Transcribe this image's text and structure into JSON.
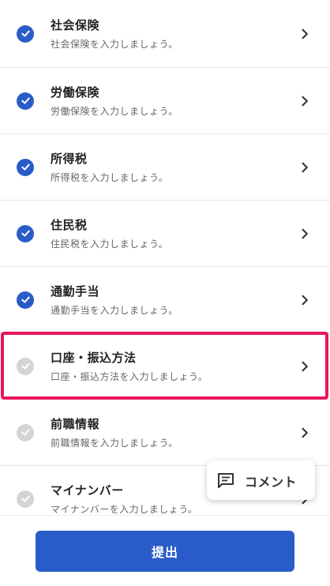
{
  "items": [
    {
      "title": "社会保険",
      "subtitle": "社会保険を入力しましょう。",
      "status": "done"
    },
    {
      "title": "労働保険",
      "subtitle": "労働保険を入力しましょう。",
      "status": "done"
    },
    {
      "title": "所得税",
      "subtitle": "所得税を入力しましょう。",
      "status": "done"
    },
    {
      "title": "住民税",
      "subtitle": "住民税を入力しましょう。",
      "status": "done"
    },
    {
      "title": "通勤手当",
      "subtitle": "通勤手当を入力しましょう。",
      "status": "done"
    },
    {
      "title": "口座・振込方法",
      "subtitle": "口座・振込方法を入力しましょう。",
      "status": "todo"
    },
    {
      "title": "前職情報",
      "subtitle": "前職情報を入力しましょう。",
      "status": "todo"
    },
    {
      "title": "マイナンバー",
      "subtitle": "マイナンバーを入力しましょう。",
      "status": "todo"
    }
  ],
  "comment": {
    "label": "コメント",
    "icon": "comment-icon"
  },
  "footer": {
    "submit_label": "提出"
  },
  "colors": {
    "accent": "#2a5cc9",
    "highlight": "#e8175d",
    "pending": "#d4d4d4"
  }
}
